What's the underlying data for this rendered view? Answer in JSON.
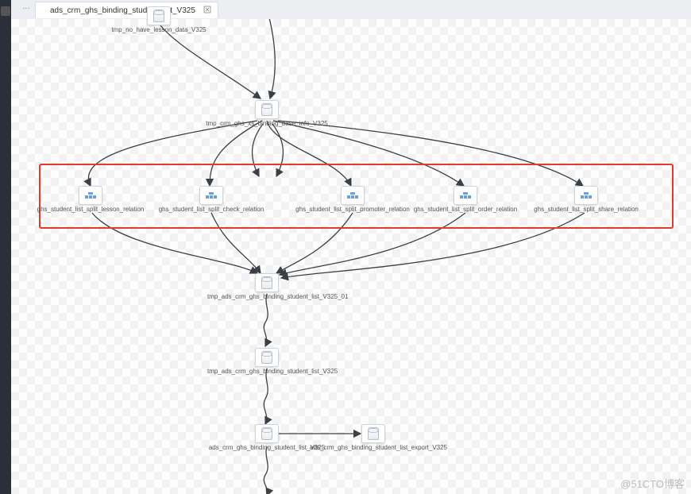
{
  "tab": {
    "title": "ads_crm_ghs_binding_student_list_V325"
  },
  "nodes": {
    "n1": {
      "label": "tmp_no_have_lesson_data_V325"
    },
    "n2": {
      "label": "tmp_crm_ghs_xs_binding_base_info_V325"
    },
    "n3": {
      "label": "ghs_student_list_split_lesson_relation"
    },
    "n4": {
      "label": "ghs_student_list_split_check_relation"
    },
    "n5": {
      "label": "ghs_student_list_split_promoter_relation"
    },
    "n6": {
      "label": "ghs_student_list_split_order_relation"
    },
    "n7": {
      "label": "ghs_student_list_split_share_relation"
    },
    "n8": {
      "label": "tmp_ads_crm_ghs_binding_student_list_V325_01"
    },
    "n9": {
      "label": "tmp_ads_crm_ghs_binding_student_list_V325"
    },
    "n10": {
      "label": "ads_crm_ghs_binding_student_list_V325"
    },
    "n11": {
      "label": "ads_crm_ghs_binding_student_list_export_V325"
    }
  },
  "watermark": "@51CTO博客"
}
